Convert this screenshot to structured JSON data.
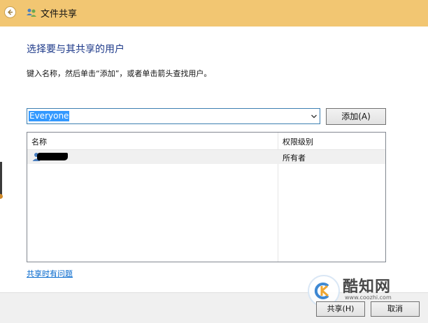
{
  "window": {
    "title": "文件共享",
    "accent_color": "#f2c672"
  },
  "main": {
    "heading": "选择要与其共享的用户",
    "instruction": "键入名称，然后单击“添加”，或者单击箭头查找用户。",
    "combo_value": "Everyone",
    "add_button": "添加(A)"
  },
  "list": {
    "columns": [
      "名称",
      "权限级别"
    ],
    "rows": [
      {
        "name": "",
        "name_redacted": true,
        "permission": "所有者"
      }
    ]
  },
  "help_link": "共享时有问题",
  "footer": {
    "share_button": "共享(H)",
    "cancel_button": "取消"
  },
  "watermark": {
    "title": "酷知网",
    "url": "www.coozhi.com"
  },
  "icons": {
    "back": "back-arrow-icon",
    "title": "sharing-users-icon",
    "dropdown": "chevron-down-icon",
    "user": "user-icon"
  }
}
